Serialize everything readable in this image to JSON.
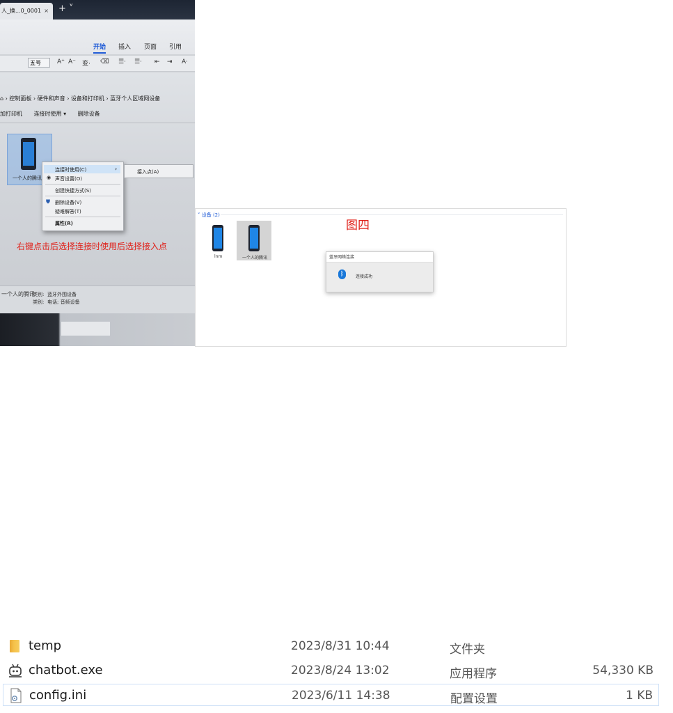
{
  "photo": {
    "tab_title": "人_换...0_0001",
    "tab_close": "×",
    "new_tab": "+ ˅",
    "ribbon_tabs": [
      {
        "label": "开始",
        "active": true
      },
      {
        "label": "插入",
        "active": false
      },
      {
        "label": "页面",
        "active": false
      },
      {
        "label": "引用",
        "active": false
      }
    ],
    "font_size_value": "五号",
    "toolbar_glyphs": [
      "A⁺",
      "A⁻",
      "变·",
      "⌫",
      "☰·",
      "☰·",
      "⇤",
      "⇥",
      "A·"
    ],
    "breadcrumb": "⌂ › 控制面板 › 硬件和声音 › 设备和打印机 › 蓝牙个人区域网设备",
    "command_bar": [
      "加打印机",
      "连接时使用 ▾",
      "删除设备"
    ],
    "device_label": "一个人的腾讯",
    "context_menu": {
      "items": [
        {
          "label": "连接时使用(C)",
          "highlighted": true,
          "has_submenu": true
        },
        {
          "label": "声音设置(O)"
        },
        {
          "label": "创建快捷方式(S)"
        },
        {
          "label": "删除设备(V)"
        },
        {
          "label": "疑难解答(T)"
        },
        {
          "label": "属性(R)"
        }
      ],
      "submenu_item": "接入点(A)"
    },
    "annotation": "右键点击后选择连接时使用后选择接入点",
    "details": {
      "name": "一个人的腾讯",
      "row1_key": "类别:",
      "row1_val": "蓝牙外围设备",
      "row2_key": "类别:",
      "row2_val": "电话; 音频设备"
    }
  },
  "screenshot": {
    "group_label": "˅ 设备 (2)",
    "devices": [
      {
        "label": "lnm",
        "selected": false
      },
      {
        "label": "一个人的腾讯",
        "selected": true
      }
    ],
    "figure_label": "图四",
    "toast": {
      "title": "蓝牙网络连接",
      "icon": "bluetooth-icon",
      "message": "连接成功"
    }
  },
  "files": [
    {
      "name": "temp",
      "icon": "folder-icon",
      "date": "2023/8/31 10:44",
      "type": "文件夹",
      "size": "",
      "selected": false
    },
    {
      "name": "chatbot.exe",
      "icon": "robot-app-icon",
      "date": "2023/8/24 13:02",
      "type": "应用程序",
      "size": "54,330 KB",
      "selected": false
    },
    {
      "name": "config.ini",
      "icon": "config-file-icon",
      "date": "2023/6/11 14:38",
      "type": "配置设置",
      "size": "1 KB",
      "selected": true
    }
  ],
  "colors": {
    "annotation_red": "#e0211a",
    "accent_blue": "#1f5bd6",
    "selection_border": "#cde0f7"
  }
}
